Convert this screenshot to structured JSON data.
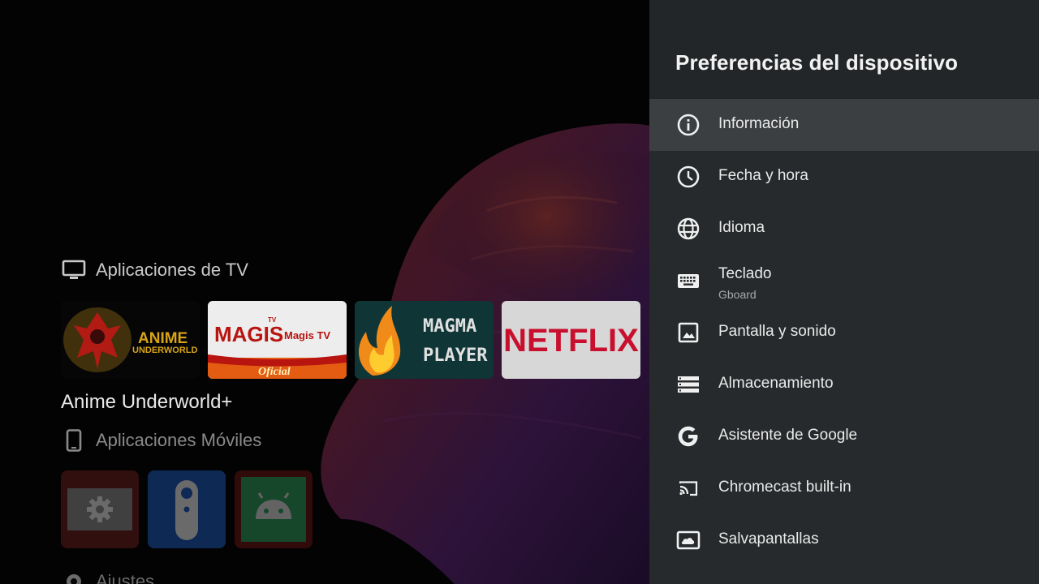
{
  "launcher": {
    "tv_apps_title": "Aplicaciones de TV",
    "focused_app_name": "Anime Underworld+",
    "mobile_apps_title": "Aplicaciones Móviles",
    "settings_row_title": "Ajustes",
    "tiles": [
      {
        "name": "anime-underworld",
        "line1": "ANIME",
        "line2": "UNDERWORLD"
      },
      {
        "name": "magis-tv",
        "logo": "MAGIS",
        "tv": "TV",
        "text": "Magis TV",
        "tag": "Oficial"
      },
      {
        "name": "magma-player",
        "line1": "MAGMA",
        "line2": "PLAYER"
      },
      {
        "name": "netflix",
        "text": "NETFLIX"
      }
    ],
    "small_tiles": [
      {
        "name": "settings-app",
        "icon": "gear-icon"
      },
      {
        "name": "remote-app",
        "icon": "remote-icon"
      },
      {
        "name": "android-app",
        "icon": "android-icon"
      }
    ]
  },
  "panel": {
    "title": "Preferencias del dispositivo",
    "items": [
      {
        "label": "Información",
        "icon": "info-icon",
        "focused": true
      },
      {
        "label": "Fecha y hora",
        "icon": "clock-icon"
      },
      {
        "label": "Idioma",
        "icon": "globe-icon"
      },
      {
        "label": "Teclado",
        "sub": "Gboard",
        "icon": "keyboard-icon"
      },
      {
        "label": "Pantalla y sonido",
        "icon": "image-icon"
      },
      {
        "label": "Almacenamiento",
        "icon": "storage-icon"
      },
      {
        "label": "Asistente de Google",
        "icon": "google-icon"
      },
      {
        "label": "Chromecast built-in",
        "icon": "cast-icon"
      },
      {
        "label": "Salvapantallas",
        "icon": "screensaver-icon"
      }
    ]
  },
  "colors": {
    "panel_bg": "#262a2c",
    "panel_focus": "#3b3f41",
    "netflix_red": "#c8102e"
  }
}
